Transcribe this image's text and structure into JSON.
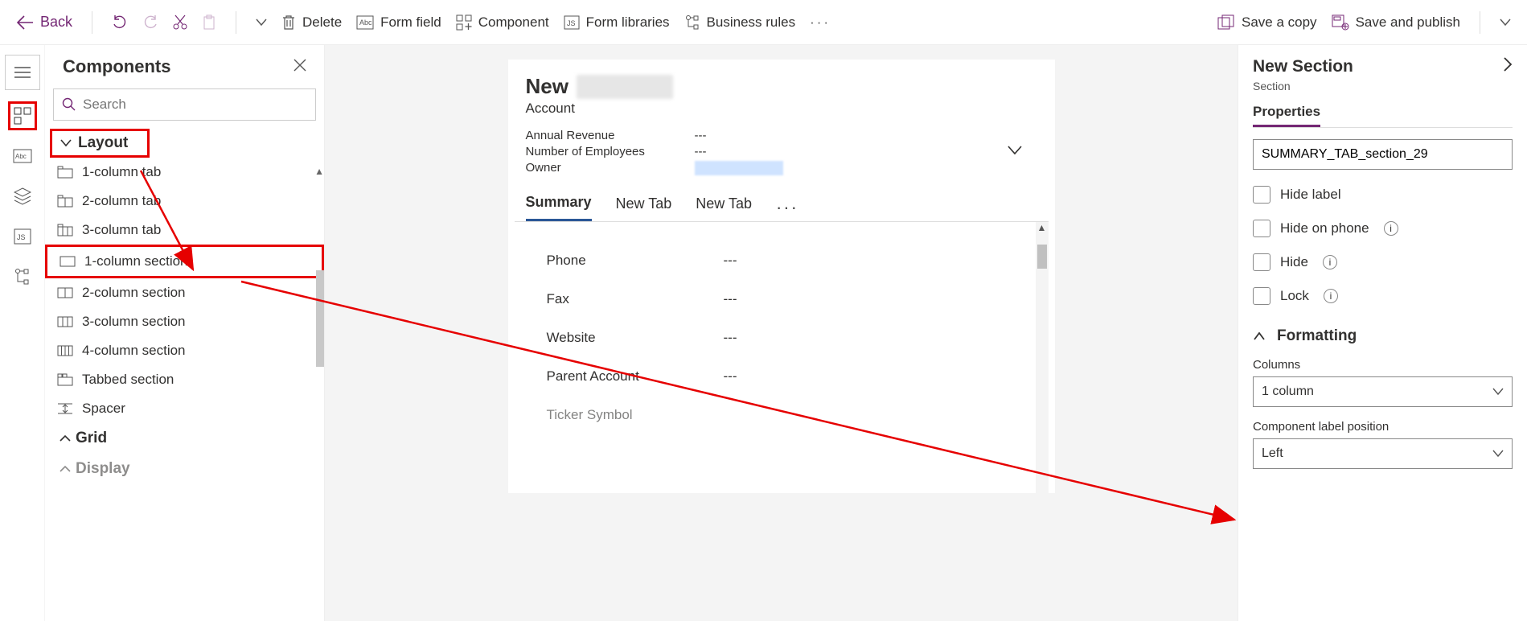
{
  "toolbar": {
    "back": "Back",
    "delete": "Delete",
    "form_field": "Form field",
    "component": "Component",
    "form_libraries": "Form libraries",
    "business_rules": "Business rules",
    "save_copy": "Save a copy",
    "save_publish": "Save and publish"
  },
  "components": {
    "title": "Components",
    "search_placeholder": "Search",
    "groups": {
      "layout": "Layout",
      "grid": "Grid",
      "display": "Display"
    },
    "layout_items": [
      "1-column tab",
      "2-column tab",
      "3-column tab",
      "1-column section",
      "2-column section",
      "3-column section",
      "4-column section",
      "Tabbed section",
      "Spacer"
    ]
  },
  "form": {
    "title": "New",
    "entity": "Account",
    "header_fields": [
      {
        "label": "Annual Revenue",
        "value": "---"
      },
      {
        "label": "Number of Employees",
        "value": "---"
      },
      {
        "label": "Owner",
        "value": ""
      }
    ],
    "tabs": [
      "Summary",
      "New Tab",
      "New Tab"
    ],
    "section_fields": [
      {
        "label": "Phone",
        "value": "---"
      },
      {
        "label": "Fax",
        "value": "---"
      },
      {
        "label": "Website",
        "value": "---"
      },
      {
        "label": "Parent Account",
        "value": "---"
      },
      {
        "label": "Ticker Symbol",
        "value": ""
      }
    ]
  },
  "props": {
    "title": "New Section",
    "subtitle": "Section",
    "tab": "Properties",
    "name_value": "SUMMARY_TAB_section_29",
    "checks": {
      "hide_label": "Hide label",
      "hide_phone": "Hide on phone",
      "hide": "Hide",
      "lock": "Lock"
    },
    "formatting": "Formatting",
    "columns_label": "Columns",
    "columns_value": "1 column",
    "label_pos_label": "Component label position",
    "label_pos_value": "Left"
  }
}
